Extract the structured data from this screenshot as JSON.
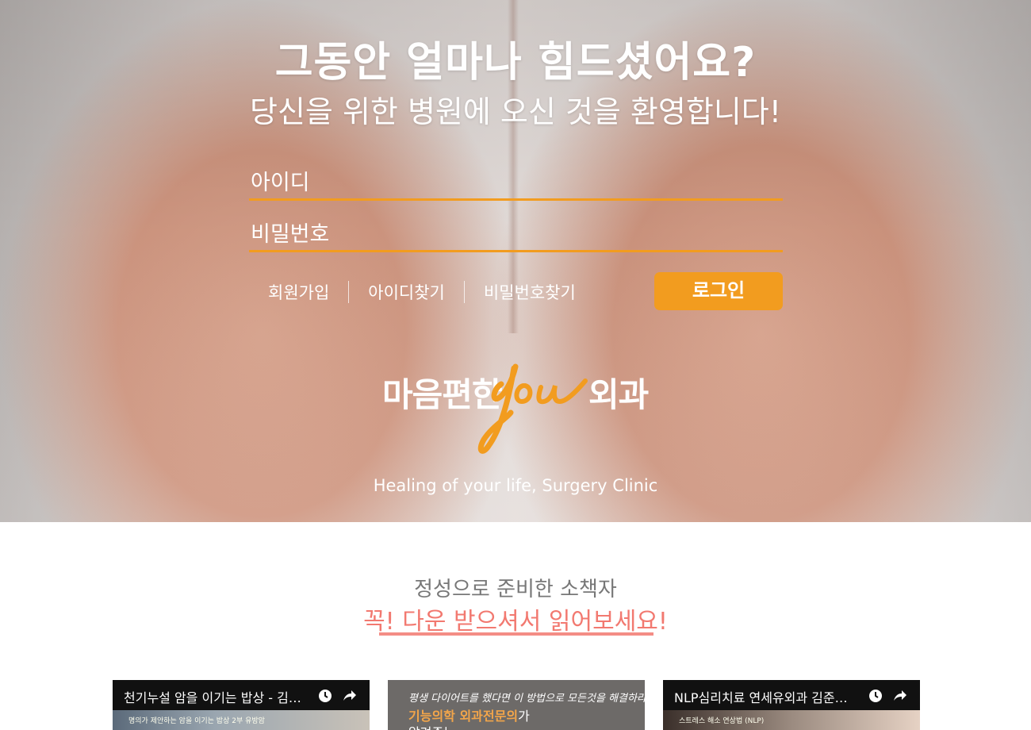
{
  "hero": {
    "headline": "그동안 얼마나 힘드셨어요?",
    "subheadline": "당신을 위한 병원에 오신 것을 환영합니다!"
  },
  "login": {
    "id_placeholder": "아이디",
    "password_placeholder": "비밀번호",
    "signup_link": "회원가입",
    "find_id_link": "아이디찾기",
    "find_password_link": "비밀번호찾기",
    "login_button": "로그인",
    "accent_color": "#f29c1f"
  },
  "logo": {
    "text_before": "마음편한",
    "script_word": "You",
    "text_after": "외과",
    "tagline": "Healing of your life, Surgery Clinic"
  },
  "booklet": {
    "line1": "정성으로 준비한 소책자",
    "line2": "꼭! 다운 받으셔서 읽어보세요!",
    "accent_color": "#f27970"
  },
  "videos": [
    {
      "title": "천기누설 암을 이기는 밥상 - 김준...",
      "thumb_caption": "명의가 제안하는 암을 이기는 밥상 2부 유방암",
      "icons": [
        "clock-icon",
        "share-icon"
      ]
    },
    {
      "line1": "평생 다이어트를 했다면 이 방법으로 모든것을 해결하라!",
      "line2_highlight": "기능의학 외과전문의",
      "line2_rest": "가",
      "line3": "알려주는"
    },
    {
      "title": "NLP심리치료 연세유외과 김준영...",
      "thumb_caption": "스트레스 해소 연상법 (NLP)",
      "icons": [
        "clock-icon",
        "share-icon"
      ]
    }
  ]
}
